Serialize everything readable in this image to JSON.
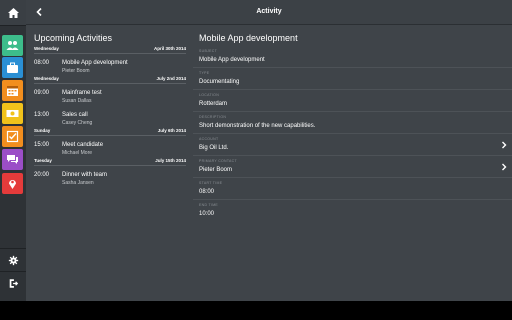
{
  "header": {
    "title": "Activity"
  },
  "nav": {
    "items": [
      {
        "icon": "contacts-icon",
        "color": "#3dbd8b"
      },
      {
        "icon": "briefcase-icon",
        "color": "#2a8fd4"
      },
      {
        "icon": "calendar-icon",
        "color": "#f28e1e"
      },
      {
        "icon": "money-icon",
        "color": "#f1c21b"
      },
      {
        "icon": "checklist-icon",
        "color": "#f28e1e"
      },
      {
        "icon": "chat-icon",
        "color": "#9b4ec7"
      },
      {
        "icon": "location-pin-icon",
        "color": "#e53b3b"
      }
    ],
    "bottom": [
      {
        "icon": "settings-icon"
      },
      {
        "icon": "logout-icon"
      }
    ]
  },
  "upcoming": {
    "title": "Upcoming Activities",
    "days": [
      {
        "day": "Wednesday",
        "date": "April 30th 2014",
        "activities": [
          {
            "time": "08:00",
            "subject": "Mobile App development",
            "person": "Pieter Boom"
          }
        ]
      },
      {
        "day": "Wednesday",
        "date": "July 2nd 2014",
        "activities": [
          {
            "time": "09:00",
            "subject": "Mainframe test",
            "person": "Susan Dallas"
          },
          {
            "time": "13:00",
            "subject": "Sales call",
            "person": "Casey Cheng"
          }
        ]
      },
      {
        "day": "Sunday",
        "date": "July 6th 2014",
        "activities": [
          {
            "time": "15:00",
            "subject": "Meet candidate",
            "person": "Michael More"
          }
        ]
      },
      {
        "day": "Tuesday",
        "date": "July 15th 2014",
        "activities": [
          {
            "time": "20:00",
            "subject": "Dinner with team",
            "person": "Sasha Jansen"
          }
        ]
      }
    ]
  },
  "detail": {
    "title": "Mobile App development",
    "fields": [
      {
        "label": "SUBJECT",
        "value": "Mobile App development",
        "link": false
      },
      {
        "label": "TYPE",
        "value": "Documentating",
        "link": false
      },
      {
        "label": "LOCATION",
        "value": "Rotterdam",
        "link": false
      },
      {
        "label": "DESCRIPTION",
        "value": "Short demonstration of the new capabilities.",
        "link": false
      },
      {
        "label": "ACCOUNT",
        "value": "Big Oil Ltd.",
        "link": true
      },
      {
        "label": "PRIMARY CONTACT",
        "value": "Pieter Boom",
        "link": true
      },
      {
        "label": "START TIME",
        "value": "08:00",
        "link": false
      },
      {
        "label": "END TIME",
        "value": "10:00",
        "link": false
      }
    ]
  }
}
